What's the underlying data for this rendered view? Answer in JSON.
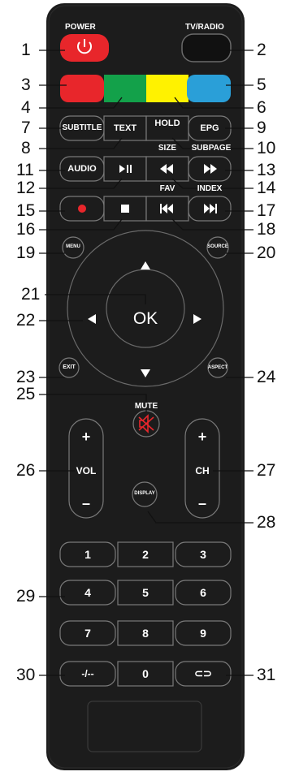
{
  "remote": {
    "power_label": "POWER",
    "tvradio_label": "TV/RADIO",
    "subtitle": "SUBTITLE",
    "text": "TEXT",
    "hold": "HOLD",
    "epg": "EPG",
    "size": "SIZE",
    "subpage": "SUBPAGE",
    "audio": "AUDIO",
    "fav": "FAV",
    "index": "INDEX",
    "menu": "MENU",
    "source": "SOURCE",
    "ok": "OK",
    "exit": "EXIT",
    "aspect": "ASPECT",
    "mute": "MUTE",
    "vol": "VOL",
    "ch": "CH",
    "plus": "+",
    "minus": "–",
    "display": "DISPLAY",
    "digits": [
      "1",
      "2",
      "3",
      "4",
      "5",
      "6",
      "7",
      "8",
      "9",
      "-/--",
      "0",
      "⊂⊃"
    ],
    "colors": {
      "body": "#1c1c1c",
      "red": "#e8262b",
      "green": "#13a14a",
      "yellow": "#fff200",
      "blue": "#2a9fd8",
      "power": "#e8262b",
      "record": "#e8262b"
    }
  },
  "callouts": [
    "1",
    "2",
    "3",
    "4",
    "5",
    "6",
    "7",
    "8",
    "9",
    "10",
    "11",
    "12",
    "13",
    "14",
    "15",
    "16",
    "17",
    "18",
    "19",
    "20",
    "21",
    "22",
    "23",
    "24",
    "25",
    "26",
    "27",
    "28",
    "29",
    "30",
    "31"
  ]
}
